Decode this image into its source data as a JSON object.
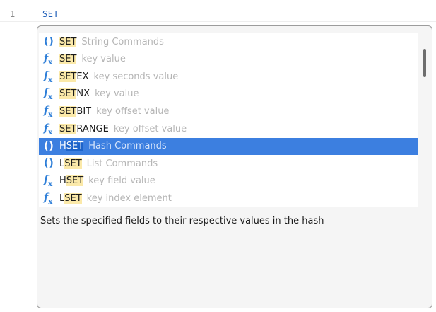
{
  "editor": {
    "line_number": "1",
    "code": "SET"
  },
  "autocomplete": {
    "items": [
      {
        "icon": "group-icon",
        "prefix": "SET",
        "rest": "",
        "hint": "String Commands"
      },
      {
        "icon": "function-icon",
        "prefix": "SET",
        "rest": "",
        "hint": "key value"
      },
      {
        "icon": "function-icon",
        "prefix": "SET",
        "rest": "EX",
        "hint": "key seconds value"
      },
      {
        "icon": "function-icon",
        "prefix": "SET",
        "rest": "NX",
        "hint": "key value"
      },
      {
        "icon": "function-icon",
        "prefix": "SET",
        "rest": "BIT",
        "hint": "key offset value"
      },
      {
        "icon": "function-icon",
        "prefix": "SET",
        "rest": "RANGE",
        "hint": "key offset value"
      },
      {
        "icon": "group-icon",
        "prefix": "SET",
        "lead": "H",
        "rest": "",
        "hint": "Hash Commands",
        "selected": true
      },
      {
        "icon": "group-icon",
        "prefix": "SET",
        "lead": "L",
        "rest": "",
        "hint": "List Commands"
      },
      {
        "icon": "function-icon",
        "prefix": "SET",
        "lead": "H",
        "rest": "",
        "hint": "key field value"
      },
      {
        "icon": "function-icon",
        "prefix": "SET",
        "lead": "L",
        "rest": "",
        "hint": "key index element"
      }
    ],
    "description": "Sets the specified fields to their respective values in the hash",
    "accent_color": "#3c7fe0",
    "highlight_color": "#fbe9a9"
  }
}
